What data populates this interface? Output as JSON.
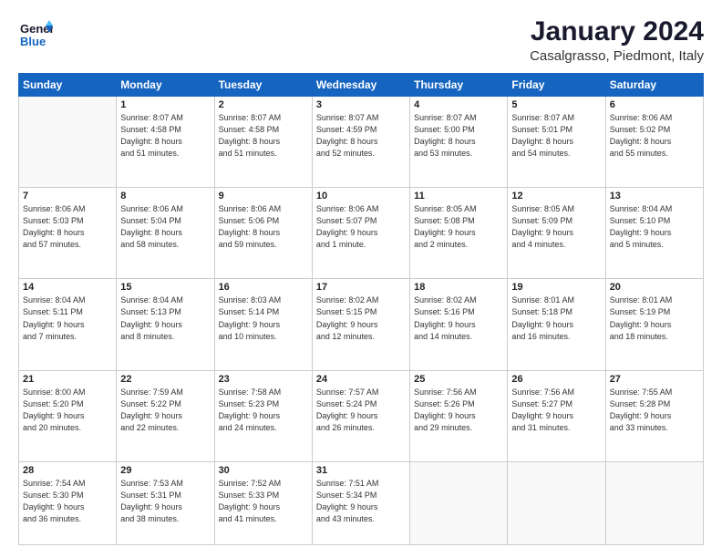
{
  "logo": {
    "general": "General",
    "blue": "Blue"
  },
  "title": "January 2024",
  "location": "Casalgrasso, Piedmont, Italy",
  "days_of_week": [
    "Sunday",
    "Monday",
    "Tuesday",
    "Wednesday",
    "Thursday",
    "Friday",
    "Saturday"
  ],
  "weeks": [
    [
      {
        "day": "",
        "info": ""
      },
      {
        "day": "1",
        "info": "Sunrise: 8:07 AM\nSunset: 4:58 PM\nDaylight: 8 hours\nand 51 minutes."
      },
      {
        "day": "2",
        "info": "Sunrise: 8:07 AM\nSunset: 4:58 PM\nDaylight: 8 hours\nand 51 minutes."
      },
      {
        "day": "3",
        "info": "Sunrise: 8:07 AM\nSunset: 4:59 PM\nDaylight: 8 hours\nand 52 minutes."
      },
      {
        "day": "4",
        "info": "Sunrise: 8:07 AM\nSunset: 5:00 PM\nDaylight: 8 hours\nand 53 minutes."
      },
      {
        "day": "5",
        "info": "Sunrise: 8:07 AM\nSunset: 5:01 PM\nDaylight: 8 hours\nand 54 minutes."
      },
      {
        "day": "6",
        "info": "Sunrise: 8:06 AM\nSunset: 5:02 PM\nDaylight: 8 hours\nand 55 minutes."
      }
    ],
    [
      {
        "day": "7",
        "info": "Sunrise: 8:06 AM\nSunset: 5:03 PM\nDaylight: 8 hours\nand 57 minutes."
      },
      {
        "day": "8",
        "info": "Sunrise: 8:06 AM\nSunset: 5:04 PM\nDaylight: 8 hours\nand 58 minutes."
      },
      {
        "day": "9",
        "info": "Sunrise: 8:06 AM\nSunset: 5:06 PM\nDaylight: 8 hours\nand 59 minutes."
      },
      {
        "day": "10",
        "info": "Sunrise: 8:06 AM\nSunset: 5:07 PM\nDaylight: 9 hours\nand 1 minute."
      },
      {
        "day": "11",
        "info": "Sunrise: 8:05 AM\nSunset: 5:08 PM\nDaylight: 9 hours\nand 2 minutes."
      },
      {
        "day": "12",
        "info": "Sunrise: 8:05 AM\nSunset: 5:09 PM\nDaylight: 9 hours\nand 4 minutes."
      },
      {
        "day": "13",
        "info": "Sunrise: 8:04 AM\nSunset: 5:10 PM\nDaylight: 9 hours\nand 5 minutes."
      }
    ],
    [
      {
        "day": "14",
        "info": "Sunrise: 8:04 AM\nSunset: 5:11 PM\nDaylight: 9 hours\nand 7 minutes."
      },
      {
        "day": "15",
        "info": "Sunrise: 8:04 AM\nSunset: 5:13 PM\nDaylight: 9 hours\nand 8 minutes."
      },
      {
        "day": "16",
        "info": "Sunrise: 8:03 AM\nSunset: 5:14 PM\nDaylight: 9 hours\nand 10 minutes."
      },
      {
        "day": "17",
        "info": "Sunrise: 8:02 AM\nSunset: 5:15 PM\nDaylight: 9 hours\nand 12 minutes."
      },
      {
        "day": "18",
        "info": "Sunrise: 8:02 AM\nSunset: 5:16 PM\nDaylight: 9 hours\nand 14 minutes."
      },
      {
        "day": "19",
        "info": "Sunrise: 8:01 AM\nSunset: 5:18 PM\nDaylight: 9 hours\nand 16 minutes."
      },
      {
        "day": "20",
        "info": "Sunrise: 8:01 AM\nSunset: 5:19 PM\nDaylight: 9 hours\nand 18 minutes."
      }
    ],
    [
      {
        "day": "21",
        "info": "Sunrise: 8:00 AM\nSunset: 5:20 PM\nDaylight: 9 hours\nand 20 minutes."
      },
      {
        "day": "22",
        "info": "Sunrise: 7:59 AM\nSunset: 5:22 PM\nDaylight: 9 hours\nand 22 minutes."
      },
      {
        "day": "23",
        "info": "Sunrise: 7:58 AM\nSunset: 5:23 PM\nDaylight: 9 hours\nand 24 minutes."
      },
      {
        "day": "24",
        "info": "Sunrise: 7:57 AM\nSunset: 5:24 PM\nDaylight: 9 hours\nand 26 minutes."
      },
      {
        "day": "25",
        "info": "Sunrise: 7:56 AM\nSunset: 5:26 PM\nDaylight: 9 hours\nand 29 minutes."
      },
      {
        "day": "26",
        "info": "Sunrise: 7:56 AM\nSunset: 5:27 PM\nDaylight: 9 hours\nand 31 minutes."
      },
      {
        "day": "27",
        "info": "Sunrise: 7:55 AM\nSunset: 5:28 PM\nDaylight: 9 hours\nand 33 minutes."
      }
    ],
    [
      {
        "day": "28",
        "info": "Sunrise: 7:54 AM\nSunset: 5:30 PM\nDaylight: 9 hours\nand 36 minutes."
      },
      {
        "day": "29",
        "info": "Sunrise: 7:53 AM\nSunset: 5:31 PM\nDaylight: 9 hours\nand 38 minutes."
      },
      {
        "day": "30",
        "info": "Sunrise: 7:52 AM\nSunset: 5:33 PM\nDaylight: 9 hours\nand 41 minutes."
      },
      {
        "day": "31",
        "info": "Sunrise: 7:51 AM\nSunset: 5:34 PM\nDaylight: 9 hours\nand 43 minutes."
      },
      {
        "day": "",
        "info": ""
      },
      {
        "day": "",
        "info": ""
      },
      {
        "day": "",
        "info": ""
      }
    ]
  ]
}
